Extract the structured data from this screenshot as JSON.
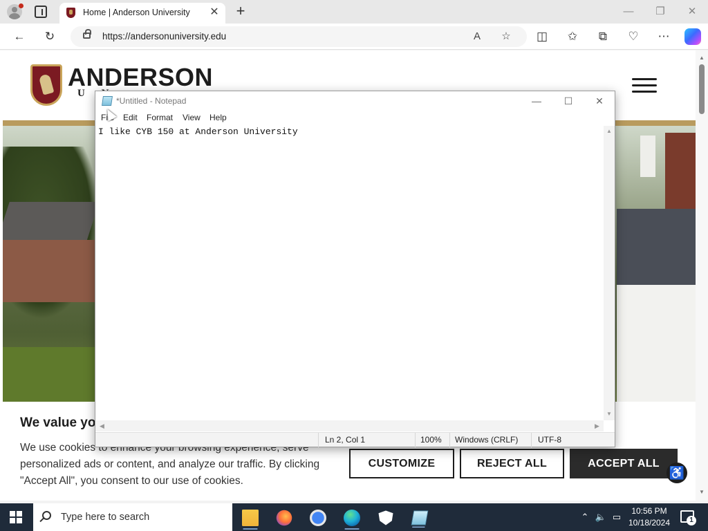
{
  "browser": {
    "tab_title": "Home | Anderson University",
    "tab_close": "✕",
    "new_tab": "+",
    "url": "https://andersonuniversity.edu",
    "read_aloud": "A",
    "window_controls": {
      "minimize": "—",
      "restore": "❐",
      "close": "✕"
    }
  },
  "site": {
    "name": "ANDERSON",
    "subtitle": "U N"
  },
  "cookie_banner": {
    "title": "We value yo",
    "text": "We use cookies to enhance your browsing experience, serve personalized ads or content, and analyze our traffic. By clicking \"Accept All\", you consent to our use of cookies.",
    "customize_label": "CUSTOMIZE",
    "reject_label": "REJECT ALL",
    "accept_label": "ACCEPT ALL"
  },
  "notepad": {
    "title": "*Untitled - Notepad",
    "menu": [
      "File",
      "Edit",
      "Format",
      "View",
      "Help"
    ],
    "content": "I like CYB 150 at Anderson University",
    "status": {
      "position": "Ln 2, Col 1",
      "zoom": "100%",
      "line_ending": "Windows (CRLF)",
      "encoding": "UTF-8"
    },
    "window_controls": {
      "minimize": "—",
      "maximize": "☐",
      "close": "✕"
    }
  },
  "taskbar": {
    "search_placeholder": "Type here to search",
    "time": "10:56 PM",
    "date": "10/18/2024",
    "notification_count": "1",
    "tray_chevron": "⌃"
  },
  "colors": {
    "brand_maroon": "#7b1a22",
    "brand_gold": "#b99b5e",
    "taskbar_bg": "#1f2b3a"
  }
}
